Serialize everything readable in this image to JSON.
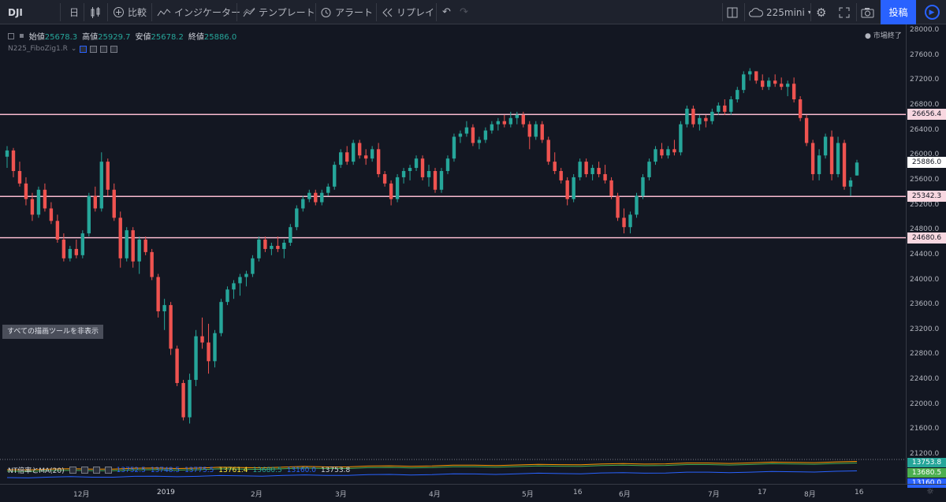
{
  "toolbar": {
    "symbol": "DJI",
    "interval": "日",
    "compare_label": "比較",
    "indicators_label": "インジケーター",
    "templates_label": "テンプレート",
    "alert_label": "アラート",
    "replay_label": "リプレイ",
    "layout_name": "225mini",
    "publish_label": "投稿"
  },
  "legend": {
    "open_label": "始値",
    "open": "25678.3",
    "high_label": "高値",
    "high": "25929.7",
    "low_label": "安値",
    "low": "25678.2",
    "close_label": "終値",
    "close": "25886.0",
    "indicator_name": "N225_FiboZig1.R",
    "market_status": "● 市場終了"
  },
  "hide_tools_label": "すべての描画ツールを非表示",
  "price_axis": {
    "labels": [
      "28000.0",
      "27600.0",
      "27200.0",
      "26800.0",
      "26400.0",
      "26000.0",
      "25600.0",
      "25200.0",
      "24800.0",
      "24400.0",
      "24000.0",
      "23600.0",
      "23200.0",
      "22800.0",
      "22400.0",
      "22000.0",
      "21600.0",
      "21200.0"
    ],
    "tags": [
      {
        "value": "26656.4",
        "type": "level"
      },
      {
        "value": "25886.0",
        "type": "last"
      },
      {
        "value": "25342.3",
        "type": "level"
      },
      {
        "value": "24680.6",
        "type": "level"
      }
    ],
    "sub_tags": [
      {
        "value": "13753.8",
        "color": "#26a69a"
      },
      {
        "value": "13680.5",
        "color": "#4caf50"
      },
      {
        "value": "13160.0",
        "color": "#2962ff"
      }
    ]
  },
  "sub_legend": {
    "name": "NT倍率とMA(20)",
    "values": [
      "13752.5",
      "13748.5",
      "13775.5",
      "13761.4",
      "13680.5",
      "13160.0",
      "13753.8"
    ]
  },
  "time_axis": [
    "12月",
    "2019",
    "2月",
    "3月",
    "4月",
    "5月",
    "16",
    "6月",
    "7月",
    "17",
    "8月",
    "16"
  ],
  "chart_data": {
    "type": "candlestick",
    "symbol": "DJI",
    "ylim": [
      21000,
      28100
    ],
    "horizontal_levels": [
      26656.4,
      25342.3,
      24680.6
    ],
    "last_price": 25886.0,
    "candles": [
      [
        25980,
        26150,
        25800,
        26080
      ],
      [
        26080,
        26120,
        25650,
        25750
      ],
      [
        25750,
        25900,
        25500,
        25550
      ],
      [
        25550,
        25650,
        25200,
        25300
      ],
      [
        25300,
        25400,
        24950,
        25050
      ],
      [
        25050,
        25500,
        25000,
        25450
      ],
      [
        25450,
        25550,
        25100,
        25150
      ],
      [
        25150,
        25250,
        24900,
        24950
      ],
      [
        24950,
        25050,
        24600,
        24650
      ],
      [
        24650,
        24750,
        24300,
        24350
      ],
      [
        24350,
        24550,
        24300,
        24500
      ],
      [
        24500,
        24650,
        24350,
        24400
      ],
      [
        24400,
        24800,
        24350,
        24750
      ],
      [
        24750,
        25400,
        24700,
        25350
      ],
      [
        25350,
        25500,
        25100,
        25150
      ],
      [
        25150,
        26050,
        25100,
        25900
      ],
      [
        25900,
        25950,
        25350,
        25450
      ],
      [
        25450,
        25550,
        24950,
        25000
      ],
      [
        25000,
        25100,
        24200,
        24350
      ],
      [
        24350,
        24850,
        24300,
        24800
      ],
      [
        24800,
        24850,
        24200,
        24300
      ],
      [
        24300,
        24700,
        24100,
        24650
      ],
      [
        24650,
        24700,
        24400,
        24450
      ],
      [
        24450,
        24500,
        24000,
        24050
      ],
      [
        24050,
        24100,
        23400,
        23500
      ],
      [
        23500,
        23700,
        23200,
        23600
      ],
      [
        23600,
        23650,
        22800,
        22900
      ],
      [
        22900,
        22950,
        22300,
        22350
      ],
      [
        22350,
        22400,
        21750,
        21800
      ],
      [
        21800,
        22500,
        21700,
        22400
      ],
      [
        22400,
        23200,
        22300,
        23100
      ],
      [
        23100,
        23400,
        22900,
        23000
      ],
      [
        23000,
        23300,
        22500,
        22700
      ],
      [
        22700,
        23200,
        22600,
        23150
      ],
      [
        23150,
        23700,
        23100,
        23650
      ],
      [
        23650,
        23900,
        23600,
        23850
      ],
      [
        23850,
        24000,
        23700,
        23950
      ],
      [
        23950,
        24100,
        23750,
        24050
      ],
      [
        24050,
        24150,
        23900,
        24100
      ],
      [
        24100,
        24400,
        24050,
        24350
      ],
      [
        24350,
        24700,
        24300,
        24650
      ],
      [
        24650,
        24700,
        24450,
        24500
      ],
      [
        24500,
        24600,
        24400,
        24550
      ],
      [
        24550,
        24700,
        24450,
        24500
      ],
      [
        24500,
        24650,
        24350,
        24600
      ],
      [
        24600,
        24900,
        24550,
        24850
      ],
      [
        24850,
        25200,
        24800,
        25150
      ],
      [
        25150,
        25350,
        25100,
        25300
      ],
      [
        25300,
        25450,
        25250,
        25400
      ],
      [
        25400,
        25450,
        25200,
        25250
      ],
      [
        25250,
        25450,
        25200,
        25400
      ],
      [
        25400,
        25550,
        25350,
        25500
      ],
      [
        25500,
        25900,
        25450,
        25850
      ],
      [
        25850,
        26100,
        25800,
        26050
      ],
      [
        26050,
        26150,
        25850,
        25900
      ],
      [
        25900,
        26250,
        25850,
        26200
      ],
      [
        26200,
        26250,
        25950,
        26000
      ],
      [
        26000,
        26100,
        25850,
        25950
      ],
      [
        25950,
        26150,
        25900,
        26100
      ],
      [
        26100,
        26200,
        25650,
        25700
      ],
      [
        25700,
        25750,
        25500,
        25550
      ],
      [
        25550,
        25600,
        25200,
        25300
      ],
      [
        25300,
        25700,
        25250,
        25650
      ],
      [
        25650,
        25800,
        25550,
        25750
      ],
      [
        25750,
        25850,
        25600,
        25800
      ],
      [
        25800,
        26000,
        25750,
        25950
      ],
      [
        25950,
        26000,
        25600,
        25650
      ],
      [
        25650,
        25850,
        25500,
        25750
      ],
      [
        25750,
        25800,
        25400,
        25450
      ],
      [
        25450,
        25800,
        25400,
        25750
      ],
      [
        25750,
        26000,
        25700,
        25950
      ],
      [
        25950,
        26350,
        25900,
        26300
      ],
      [
        26300,
        26400,
        26200,
        26350
      ],
      [
        26350,
        26550,
        26300,
        26450
      ],
      [
        26450,
        26500,
        26150,
        26200
      ],
      [
        26200,
        26300,
        26100,
        26250
      ],
      [
        26250,
        26450,
        26200,
        26400
      ],
      [
        26400,
        26550,
        26350,
        26500
      ],
      [
        26500,
        26600,
        26400,
        26550
      ],
      [
        26550,
        26650,
        26450,
        26500
      ],
      [
        26500,
        26700,
        26450,
        26600
      ],
      [
        26600,
        26700,
        26500,
        26650
      ],
      [
        26650,
        26700,
        26450,
        26500
      ],
      [
        26500,
        26550,
        26100,
        26300
      ],
      [
        26300,
        26550,
        26250,
        26500
      ],
      [
        26500,
        26550,
        26200,
        26250
      ],
      [
        26250,
        26300,
        25850,
        25900
      ],
      [
        25900,
        26050,
        25700,
        25750
      ],
      [
        25750,
        25800,
        25550,
        25600
      ],
      [
        25600,
        25650,
        25200,
        25300
      ],
      [
        25300,
        25700,
        25250,
        25650
      ],
      [
        25650,
        25950,
        25600,
        25900
      ],
      [
        25900,
        25950,
        25650,
        25700
      ],
      [
        25700,
        25850,
        25600,
        25800
      ],
      [
        25800,
        25900,
        25650,
        25700
      ],
      [
        25700,
        25850,
        25550,
        25600
      ],
      [
        25600,
        25650,
        25300,
        25350
      ],
      [
        25350,
        25400,
        24950,
        25000
      ],
      [
        25000,
        25150,
        24750,
        24850
      ],
      [
        24850,
        25100,
        24750,
        25050
      ],
      [
        25050,
        25400,
        25000,
        25350
      ],
      [
        25350,
        25700,
        25300,
        25650
      ],
      [
        25650,
        25950,
        25600,
        25900
      ],
      [
        25900,
        26150,
        25850,
        26100
      ],
      [
        26100,
        26200,
        25950,
        26000
      ],
      [
        26000,
        26150,
        25950,
        26100
      ],
      [
        26100,
        26250,
        26000,
        26050
      ],
      [
        26050,
        26550,
        26000,
        26500
      ],
      [
        26500,
        26800,
        26450,
        26750
      ],
      [
        26750,
        26800,
        26450,
        26500
      ],
      [
        26500,
        26650,
        26400,
        26600
      ],
      [
        26600,
        26650,
        26450,
        26550
      ],
      [
        26550,
        26750,
        26500,
        26700
      ],
      [
        26700,
        26850,
        26650,
        26800
      ],
      [
        26800,
        26900,
        26650,
        26700
      ],
      [
        26700,
        26950,
        26650,
        26900
      ],
      [
        26900,
        27100,
        26850,
        27050
      ],
      [
        27050,
        27350,
        27000,
        27300
      ],
      [
        27300,
        27400,
        27200,
        27350
      ],
      [
        27350,
        27350,
        27150,
        27200
      ],
      [
        27200,
        27300,
        27050,
        27100
      ],
      [
        27100,
        27250,
        27050,
        27200
      ],
      [
        27200,
        27300,
        27100,
        27150
      ],
      [
        27150,
        27250,
        27050,
        27100
      ],
      [
        27100,
        27200,
        26950,
        27150
      ],
      [
        27150,
        27250,
        26850,
        26900
      ],
      [
        26900,
        26950,
        26550,
        26600
      ],
      [
        26600,
        26650,
        26150,
        26200
      ],
      [
        26200,
        26250,
        25600,
        25700
      ],
      [
        25700,
        26100,
        25600,
        26000
      ],
      [
        26000,
        26350,
        25950,
        26300
      ],
      [
        26300,
        26400,
        25600,
        25700
      ],
      [
        25700,
        26300,
        25650,
        26200
      ],
      [
        26200,
        26250,
        25450,
        25500
      ],
      [
        25500,
        25650,
        25350,
        25600
      ],
      [
        25678.3,
        25929.7,
        25678.2,
        25886.0
      ]
    ]
  }
}
